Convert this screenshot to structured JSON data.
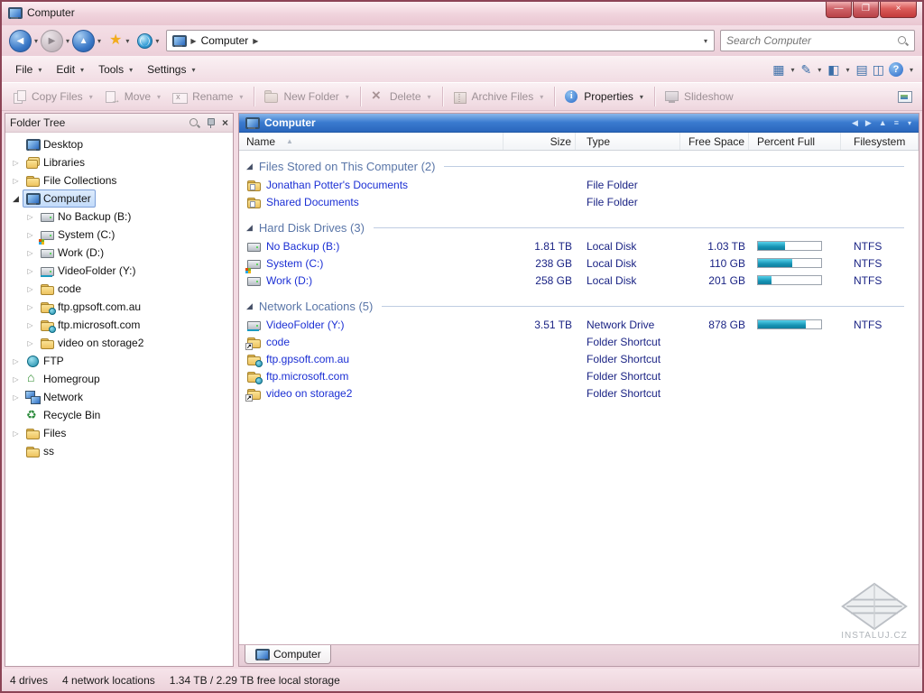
{
  "window": {
    "title": "Computer"
  },
  "icons": {
    "minimize": "—",
    "maximize": "❐",
    "close": "×",
    "back": "◀",
    "forward": "▶",
    "up": "▲",
    "caret": "▾",
    "crumb_arrow": "▶",
    "star": "★",
    "twisty_collapsed": "▷",
    "twisty_expanded": "◢",
    "group_expanded": "◢",
    "sort_asc": "▲",
    "menu_view_grid": "▦",
    "menu_pencil": "✎",
    "menu_pane_single": "◧",
    "menu_columns": "▤",
    "menu_dual_pane": "◫",
    "menu_hamburger": "≡",
    "header_back": "◀",
    "header_forward": "▶",
    "header_up": "▲",
    "tree_close": "×"
  },
  "nav": {
    "breadcrumb": {
      "items": [
        "Computer"
      ]
    },
    "search": {
      "placeholder": "Search Computer"
    }
  },
  "menubar": {
    "items": [
      {
        "label": "File"
      },
      {
        "label": "Edit"
      },
      {
        "label": "Tools"
      },
      {
        "label": "Settings"
      }
    ]
  },
  "toolbar": {
    "buttons": [
      {
        "label": "Copy Files",
        "icon": "copy",
        "enabled": false,
        "caret": true,
        "sep_after": false
      },
      {
        "label": "Move",
        "icon": "move",
        "enabled": false,
        "caret": true,
        "sep_after": false
      },
      {
        "label": "Rename",
        "icon": "rename",
        "enabled": false,
        "caret": true,
        "sep_after": true
      },
      {
        "label": "New Folder",
        "icon": "new-folder",
        "enabled": false,
        "caret": true,
        "sep_after": true
      },
      {
        "label": "Delete",
        "icon": "delete",
        "enabled": false,
        "caret": true,
        "sep_after": true
      },
      {
        "label": "Archive Files",
        "icon": "archive",
        "enabled": false,
        "caret": true,
        "sep_after": true
      },
      {
        "label": "Properties",
        "icon": "properties",
        "enabled": true,
        "caret": true,
        "sep_after": true
      },
      {
        "label": "Slideshow",
        "icon": "slideshow",
        "enabled": false,
        "caret": false,
        "sep_after": false
      }
    ]
  },
  "folder_tree": {
    "title": "Folder Tree",
    "items": [
      {
        "label": "Desktop",
        "level": 0,
        "icon": "monitor",
        "expand": "none",
        "selected": false
      },
      {
        "label": "Libraries",
        "level": 0,
        "icon": "lib",
        "expand": "collapsed",
        "selected": false
      },
      {
        "label": "File Collections",
        "level": 0,
        "icon": "folder",
        "expand": "collapsed",
        "selected": false
      },
      {
        "label": "Computer",
        "level": 0,
        "icon": "monitor",
        "expand": "expanded",
        "selected": true
      },
      {
        "label": "No Backup (B:)",
        "level": 1,
        "icon": "drive",
        "expand": "collapsed",
        "selected": false
      },
      {
        "label": "System (C:)",
        "level": 1,
        "icon": "drive-sys",
        "expand": "collapsed",
        "selected": false
      },
      {
        "label": "Work (D:)",
        "level": 1,
        "icon": "drive",
        "expand": "collapsed",
        "selected": false
      },
      {
        "label": "VideoFolder (Y:)",
        "level": 1,
        "icon": "netdrive",
        "expand": "collapsed",
        "selected": false
      },
      {
        "label": "code",
        "level": 1,
        "icon": "folder",
        "expand": "collapsed",
        "selected": false
      },
      {
        "label": "ftp.gpsoft.com.au",
        "level": 1,
        "icon": "folder-globe",
        "expand": "collapsed",
        "selected": false
      },
      {
        "label": "ftp.microsoft.com",
        "level": 1,
        "icon": "folder-globe",
        "expand": "collapsed",
        "selected": false
      },
      {
        "label": "video on storage2",
        "level": 1,
        "icon": "folder",
        "expand": "collapsed",
        "selected": false
      },
      {
        "label": "FTP",
        "level": 0,
        "icon": "globe",
        "expand": "collapsed",
        "selected": false
      },
      {
        "label": "Homegroup",
        "level": 0,
        "icon": "home",
        "expand": "collapsed",
        "selected": false
      },
      {
        "label": "Network",
        "level": 0,
        "icon": "network",
        "expand": "collapsed",
        "selected": false
      },
      {
        "label": "Recycle Bin",
        "level": 0,
        "icon": "recycle",
        "expand": "none",
        "selected": false
      },
      {
        "label": "Files",
        "level": 0,
        "icon": "folder",
        "expand": "collapsed",
        "selected": false
      },
      {
        "label": "ss",
        "level": 0,
        "icon": "folder",
        "expand": "none",
        "selected": false
      }
    ]
  },
  "main": {
    "header": {
      "title": "Computer"
    },
    "columns": [
      {
        "label": "Name",
        "align": "left",
        "sorted": true
      },
      {
        "label": "Size",
        "align": "right",
        "sorted": false
      },
      {
        "label": "Type",
        "align": "left",
        "sorted": false
      },
      {
        "label": "Free Space",
        "align": "right",
        "sorted": false
      },
      {
        "label": "Percent Full",
        "align": "left",
        "sorted": false
      },
      {
        "label": "Filesystem",
        "align": "left",
        "sorted": false
      }
    ],
    "groups": [
      {
        "label": "Files Stored on This Computer (2)",
        "rows": [
          {
            "name": "Jonathan Potter's Documents",
            "icon": "docfolder",
            "size": "",
            "type": "File Folder",
            "free": "",
            "percent": null,
            "fs": ""
          },
          {
            "name": "Shared Documents",
            "icon": "docfolder",
            "size": "",
            "type": "File Folder",
            "free": "",
            "percent": null,
            "fs": ""
          }
        ]
      },
      {
        "label": "Hard Disk Drives (3)",
        "rows": [
          {
            "name": "No Backup (B:)",
            "icon": "drive",
            "size": "1.81 TB",
            "type": "Local Disk",
            "free": "1.03 TB",
            "percent": 43,
            "fs": "NTFS"
          },
          {
            "name": "System (C:)",
            "icon": "drive-sys",
            "size": "238 GB",
            "type": "Local Disk",
            "free": "110 GB",
            "percent": 54,
            "fs": "NTFS"
          },
          {
            "name": "Work (D:)",
            "icon": "drive",
            "size": "258 GB",
            "type": "Local Disk",
            "free": "201 GB",
            "percent": 22,
            "fs": "NTFS"
          }
        ]
      },
      {
        "label": "Network Locations (5)",
        "rows": [
          {
            "name": "VideoFolder (Y:)",
            "icon": "netdrive",
            "size": "3.51 TB",
            "type": "Network Drive",
            "free": "878 GB",
            "percent": 76,
            "fs": "NTFS"
          },
          {
            "name": "code",
            "icon": "folder-shortcut",
            "size": "",
            "type": "Folder Shortcut",
            "free": "",
            "percent": null,
            "fs": ""
          },
          {
            "name": "ftp.gpsoft.com.au",
            "icon": "folder-globe",
            "size": "",
            "type": "Folder Shortcut",
            "free": "",
            "percent": null,
            "fs": ""
          },
          {
            "name": "ftp.microsoft.com",
            "icon": "folder-globe",
            "size": "",
            "type": "Folder Shortcut",
            "free": "",
            "percent": null,
            "fs": ""
          },
          {
            "name": "video on storage2",
            "icon": "folder-shortcut",
            "size": "",
            "type": "Folder Shortcut",
            "free": "",
            "percent": null,
            "fs": ""
          }
        ]
      }
    ]
  },
  "tabs": [
    {
      "label": "Computer",
      "active": true
    }
  ],
  "status": {
    "segments": [
      "4 drives",
      "4 network locations",
      "1.34 TB / 2.29 TB free local storage"
    ]
  },
  "watermark": {
    "text": "INSTALUJ.CZ"
  }
}
